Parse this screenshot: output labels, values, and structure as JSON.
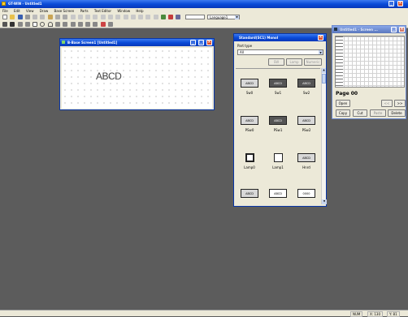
{
  "app": {
    "title": "GT-WIN - Untitled1"
  },
  "menu": [
    "File",
    "Edit",
    "View",
    "Draw",
    "Base Screen",
    "Parts",
    "Text Editor",
    "Window",
    "Help"
  ],
  "toolbar": {
    "layer_dropdown_value": "Language1"
  },
  "screen_window": {
    "title": "B-Base Screen1 [Untitled1]",
    "canvas_text": "ABCD"
  },
  "parts_window": {
    "title": "Standard(SC1) Monol",
    "parttype_label": "Part type",
    "parttype_value": "All",
    "buttons": [
      "SW",
      "Lamp",
      "Numeric"
    ],
    "items": [
      {
        "icon_text": "ABCD",
        "label": "Sw0"
      },
      {
        "icon_text": "ABCD",
        "label": "Sw1"
      },
      {
        "icon_text": "ABCD",
        "label": "Sw2"
      },
      {
        "icon_text": "ABCD",
        "label": "PSw0"
      },
      {
        "icon_text": "ABCD",
        "label": "PSw1"
      },
      {
        "icon_text": "ABCD",
        "label": "PSw2"
      },
      {
        "icon_text": "",
        "label": "Lamp0"
      },
      {
        "icon_text": "",
        "label": "Lamp1"
      },
      {
        "icon_text": "ABCD",
        "label": "Hnrd"
      },
      {
        "icon_text": "ABCD",
        "label": ""
      },
      {
        "icon_text": "ABCD",
        "label": ""
      },
      {
        "icon_text": "0000",
        "label": ""
      }
    ]
  },
  "screen_list_window": {
    "title": "Untitled1 - Screen ...",
    "page_label": "Page 00",
    "buttons_row1": [
      "Open",
      "<<",
      ">>"
    ],
    "buttons_row2": [
      "Copy",
      "Cut",
      "Paste",
      "Delete"
    ]
  },
  "statusbar": {
    "fields": [
      "NUM",
      "X: 130",
      "Y: 81"
    ]
  }
}
